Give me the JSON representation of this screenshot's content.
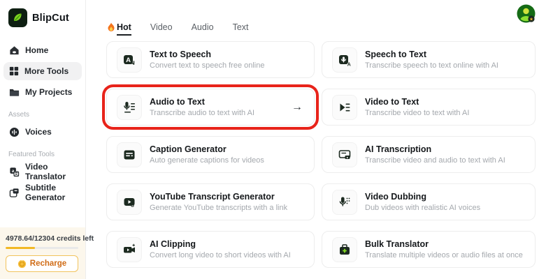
{
  "brand": {
    "name": "BlipCut"
  },
  "sidebar": {
    "nav": [
      {
        "label": "Home",
        "icon": "home-icon"
      },
      {
        "label": "More Tools",
        "icon": "grid-icon",
        "active": true
      },
      {
        "label": "My Projects",
        "icon": "folder-icon"
      }
    ],
    "sections": [
      {
        "label": "Assets",
        "items": [
          {
            "label": "Voices",
            "icon": "voice-waveform-icon"
          }
        ]
      },
      {
        "label": "Featured Tools",
        "items": [
          {
            "label": "Video Translator",
            "icon": "video-translator-icon"
          },
          {
            "label": "Subtitle Generator",
            "icon": "subtitle-generator-icon"
          }
        ]
      }
    ],
    "credits": {
      "text": "4978.64/12304 credits left",
      "progress_percent": 40,
      "progress_style": "width:40%",
      "recharge_label": "Recharge",
      "coin_icon": "coin-icon"
    }
  },
  "header": {
    "tabs": [
      {
        "label": "Hot",
        "icon": "flame-icon",
        "active": true
      },
      {
        "label": "Video"
      },
      {
        "label": "Audio"
      },
      {
        "label": "Text"
      }
    ]
  },
  "cards": [
    {
      "title": "Text to Speech",
      "subtitle": "Convert text to speech free online",
      "icon": "text-to-speech-icon"
    },
    {
      "title": "Speech to Text",
      "subtitle": "Transcribe speech to text online with AI",
      "icon": "speech-to-text-icon"
    },
    {
      "title": "Audio to Text",
      "subtitle": "Transcribe audio to text with AI",
      "icon": "audio-to-text-icon",
      "highlighted": true,
      "arrow": "→"
    },
    {
      "title": "Video to Text",
      "subtitle": "Transcribe video to text with AI",
      "icon": "video-to-text-icon"
    },
    {
      "title": "Caption Generator",
      "subtitle": "Auto generate captions for videos",
      "icon": "caption-generator-icon"
    },
    {
      "title": "AI Transcription",
      "subtitle": "Transcribe video and audio to text with AI",
      "icon": "ai-transcription-icon"
    },
    {
      "title": "YouTube Transcript Generator",
      "subtitle": "Generate YouTube transcripts with a link",
      "icon": "youtube-transcript-icon"
    },
    {
      "title": "Video Dubbing",
      "subtitle": "Dub videos with realistic AI voices",
      "icon": "video-dubbing-icon"
    },
    {
      "title": "AI Clipping",
      "subtitle": "Convert long video to short videos with AI",
      "icon": "ai-clipping-icon"
    },
    {
      "title": "Bulk Translator",
      "subtitle": "Translate multiple videos or audio files at once",
      "icon": "bulk-translator-icon"
    }
  ],
  "colors": {
    "highlight_red": "#e8231a",
    "progress_amber": "#f2b824",
    "recharge_orange": "#d06c16",
    "brand_green": "#7ed321",
    "icon_dark": "#1c2a20"
  }
}
